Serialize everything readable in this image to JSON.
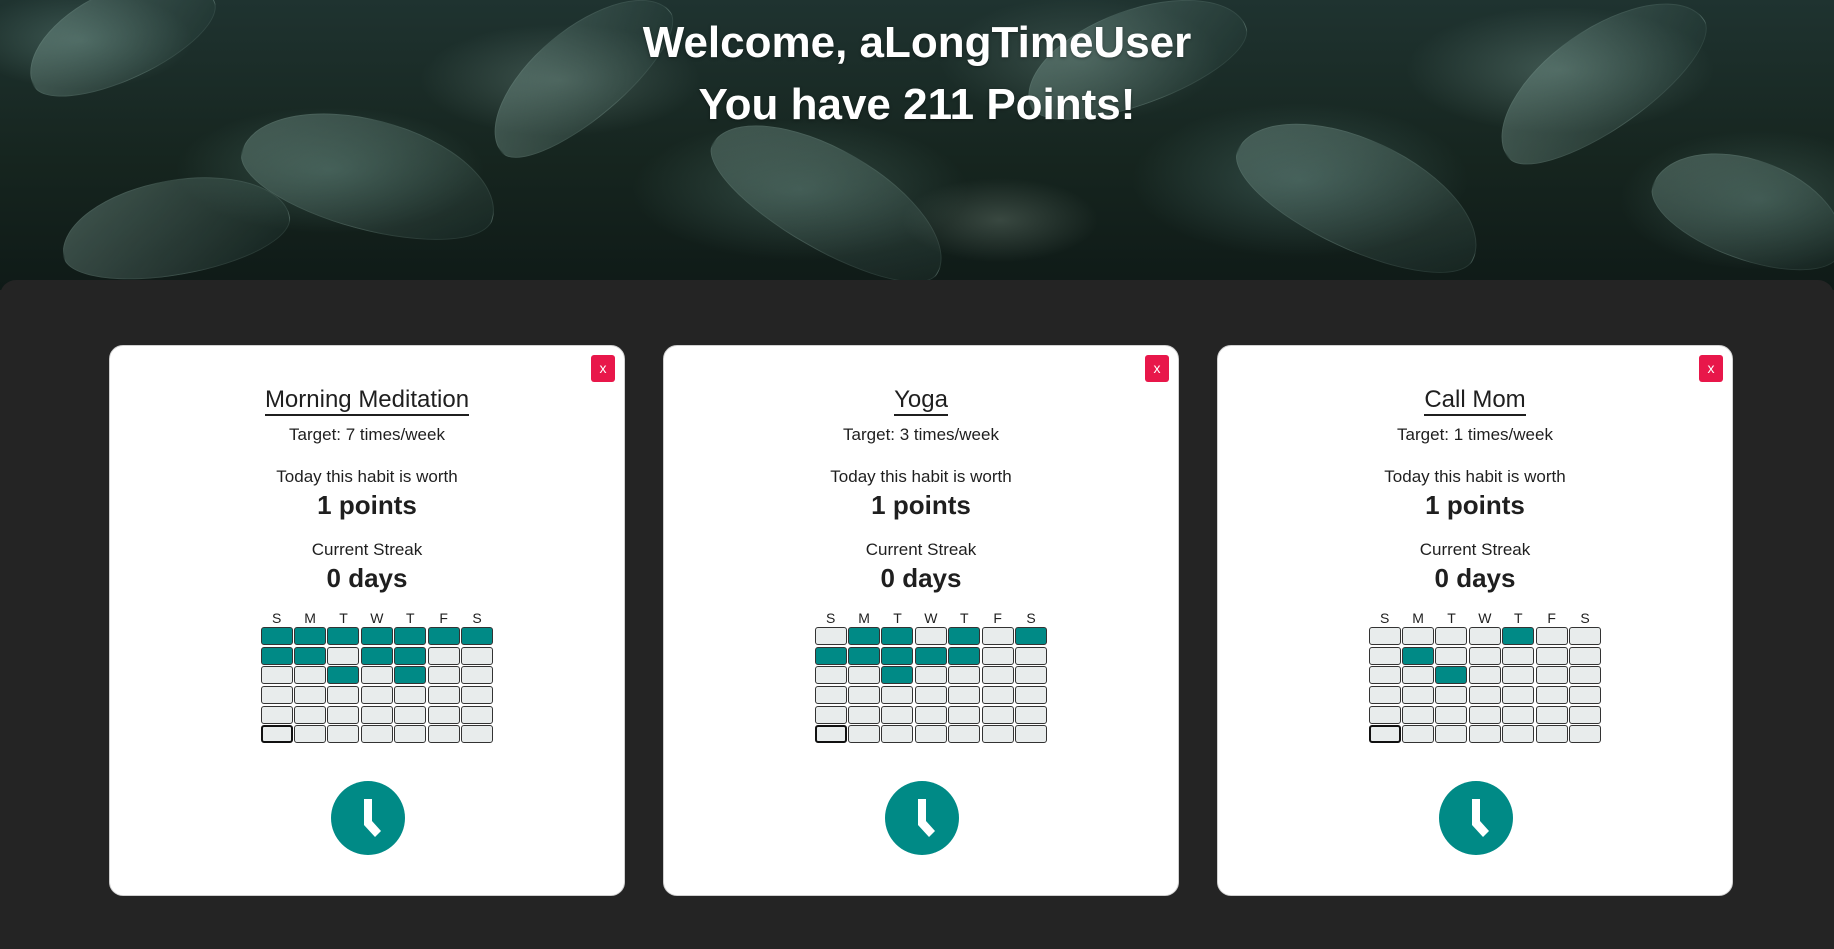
{
  "header": {
    "welcome": "Welcome, aLongTimeUser",
    "points_line": "You have 211 Points!"
  },
  "colors": {
    "accent": "#008a86",
    "delete": "#e8174a",
    "background": "#242424"
  },
  "weekday_labels": [
    "S",
    "M",
    "T",
    "W",
    "T",
    "F",
    "S"
  ],
  "habits": [
    {
      "name": "Morning Meditation",
      "target": "Target: 7 times/week",
      "worth_label": "Today this habit is worth",
      "worth_value": "1 points",
      "streak_label": "Current Streak",
      "streak_value": "0 days",
      "close_label": "x",
      "grid": [
        [
          1,
          1,
          1,
          1,
          1,
          1,
          1
        ],
        [
          1,
          1,
          0,
          1,
          1,
          0,
          0
        ],
        [
          0,
          0,
          1,
          0,
          1,
          0,
          0
        ],
        [
          0,
          0,
          0,
          0,
          0,
          0,
          0
        ],
        [
          0,
          0,
          0,
          0,
          0,
          0,
          0
        ],
        [
          0,
          0,
          0,
          0,
          0,
          0,
          0
        ]
      ]
    },
    {
      "name": "Yoga",
      "target": "Target: 3 times/week",
      "worth_label": "Today this habit is worth",
      "worth_value": "1 points",
      "streak_label": "Current Streak",
      "streak_value": "0 days",
      "close_label": "x",
      "grid": [
        [
          0,
          1,
          1,
          0,
          1,
          0,
          1
        ],
        [
          1,
          1,
          1,
          1,
          1,
          0,
          0
        ],
        [
          0,
          0,
          1,
          0,
          0,
          0,
          0
        ],
        [
          0,
          0,
          0,
          0,
          0,
          0,
          0
        ],
        [
          0,
          0,
          0,
          0,
          0,
          0,
          0
        ],
        [
          0,
          0,
          0,
          0,
          0,
          0,
          0
        ]
      ]
    },
    {
      "name": "Call Mom",
      "target": "Target: 1 times/week",
      "worth_label": "Today this habit is worth",
      "worth_value": "1 points",
      "streak_label": "Current Streak",
      "streak_value": "0 days",
      "close_label": "x",
      "grid": [
        [
          0,
          0,
          0,
          0,
          1,
          0,
          0
        ],
        [
          0,
          1,
          0,
          0,
          0,
          0,
          0
        ],
        [
          0,
          0,
          1,
          0,
          0,
          0,
          0
        ],
        [
          0,
          0,
          0,
          0,
          0,
          0,
          0
        ],
        [
          0,
          0,
          0,
          0,
          0,
          0,
          0
        ],
        [
          0,
          0,
          0,
          0,
          0,
          0,
          0
        ]
      ]
    }
  ],
  "today_cell": {
    "row": 5,
    "col": 0
  },
  "icons": {
    "checkin": "clock-icon",
    "delete": "close-icon"
  }
}
